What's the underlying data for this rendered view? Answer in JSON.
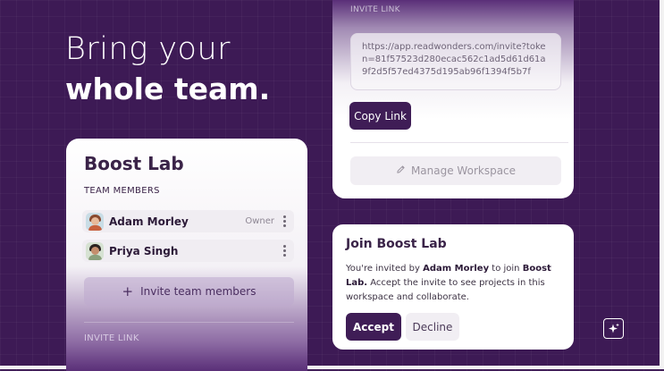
{
  "headline": {
    "line1": "Bring your",
    "line2": "whole team."
  },
  "workspace_card": {
    "title": "Boost Lab",
    "section_label": "TEAM MEMBERS",
    "members": [
      {
        "name": "Adam Morley",
        "role": "Owner"
      },
      {
        "name": "Priya Singh",
        "role": ""
      }
    ],
    "invite_button": "Invite team members",
    "invite_link_label": "INVITE LINK"
  },
  "invite_link_card": {
    "label": "INVITE LINK",
    "link": "https://app.readwonders.com/invite?token=81f57523d280ecac562c1ad5d61d61a9f2d5f57ed4375d195ab96f1394f5b7f",
    "copy_button": "Copy Link",
    "manage_button": "Manage Workspace"
  },
  "join_card": {
    "title": "Join Boost Lab",
    "desc_prefix": "You're invited by ",
    "inviter": "Adam Morley",
    "desc_middle": " to join ",
    "workspace": "Boost Lab.",
    "desc_suffix": " Accept the invite to see projects in this workspace and collaborate.",
    "accept_button": "Accept",
    "decline_button": "Decline"
  },
  "icons": {
    "plus": "plus-icon",
    "pencil": "pencil-icon",
    "kebab": "kebab-icon",
    "sparkle": "sparkle-icon"
  },
  "colors": {
    "background": "#3d1a55",
    "primary_button": "#3f1d56",
    "card": "#ffffff"
  }
}
